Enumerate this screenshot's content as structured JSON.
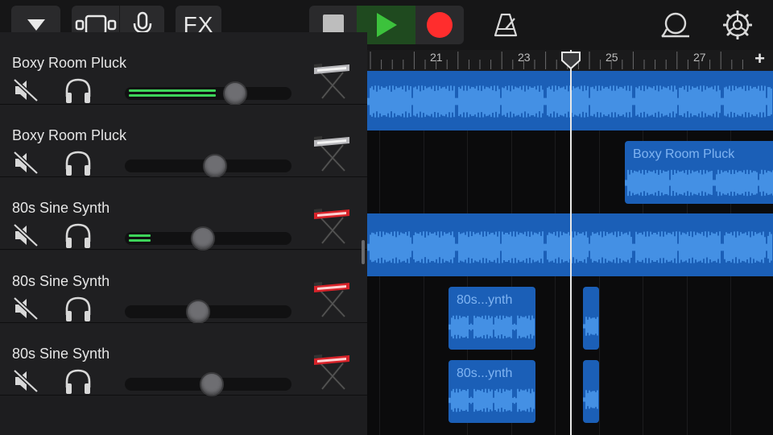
{
  "toolbar": {
    "fx_label": "FX",
    "buttons": [
      "view-dropdown",
      "tracks-view",
      "microphone",
      "fx",
      "stop",
      "play",
      "record",
      "metronome",
      "loop-browser",
      "settings"
    ]
  },
  "colors": {
    "accent_play": "#3cc23c",
    "record": "#ff2d2d",
    "region": "#1b5fb7",
    "meter": "#3dd45a"
  },
  "timeline": {
    "bar_numbers": [
      "21",
      "23",
      "25",
      "27"
    ],
    "add_label": "+"
  },
  "tracks": [
    {
      "name": "Boxy Room Pluck",
      "volume": 0.66,
      "meter": 0.6,
      "instrument": "keyboard-silver"
    },
    {
      "name": "Boxy Room Pluck",
      "volume": 0.54,
      "meter": 0,
      "instrument": "keyboard-silver"
    },
    {
      "name": "80s Sine Synth",
      "volume": 0.47,
      "meter": 0.15,
      "instrument": "keyboard-red"
    },
    {
      "name": "80s Sine Synth",
      "volume": 0.44,
      "meter": 0,
      "instrument": "keyboard-red"
    },
    {
      "name": "80s Sine Synth",
      "volume": 0.52,
      "meter": 0,
      "instrument": "keyboard-red"
    }
  ],
  "regions": {
    "r2_label": "Boxy Room Pluck",
    "r4_label": "80s...ynth",
    "r5_label": "80s...ynth"
  }
}
